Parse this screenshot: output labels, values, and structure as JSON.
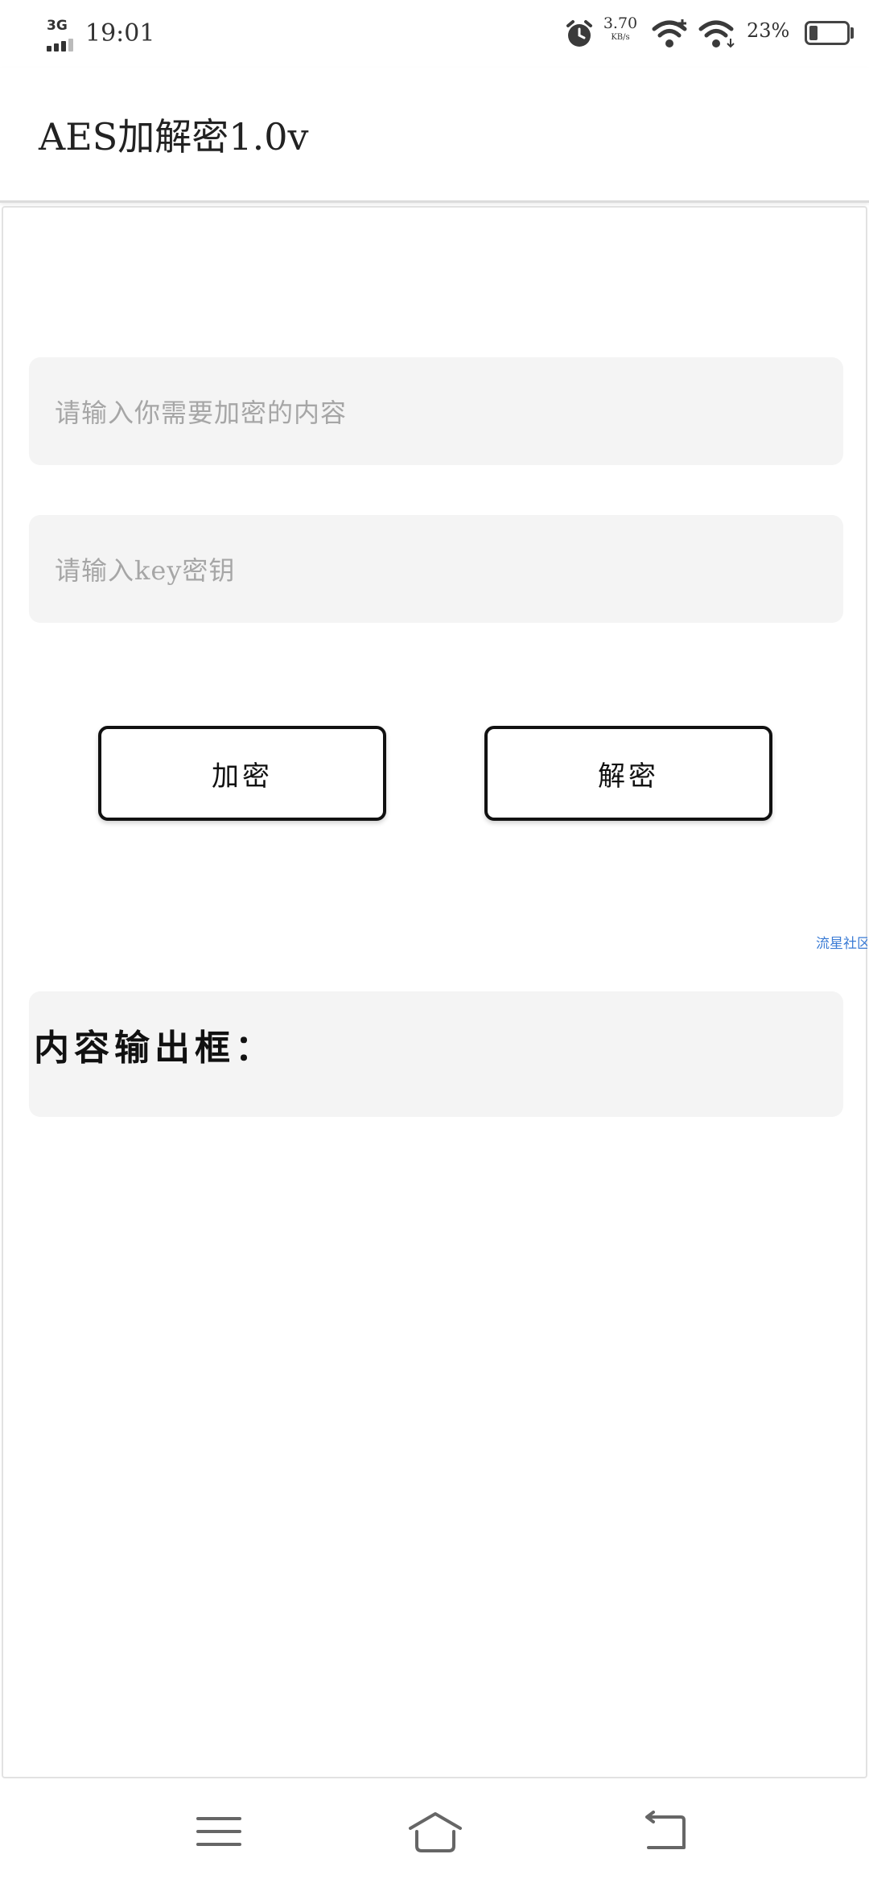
{
  "status_bar": {
    "network_type": "3G",
    "time": "19:01",
    "speed_value": "3.70",
    "speed_unit": "KB/s",
    "battery_percent": "23%",
    "battery_level": 0.23,
    "icons": [
      "signal-icon",
      "alarm-icon",
      "wifi-plus-icon",
      "wifi-icon",
      "battery-icon"
    ]
  },
  "app_bar": {
    "title": "AES加解密1.0v"
  },
  "form": {
    "plaintext_placeholder": "请输入你需要加密的内容",
    "key_placeholder": "请输入key密钥",
    "encrypt_label": "加密",
    "decrypt_label": "解密"
  },
  "community_link": "流星社区",
  "output": {
    "label": "内容输出框：",
    "value": ""
  },
  "nav_bar": {
    "icons": [
      "menu-icon",
      "home-icon",
      "back-icon"
    ]
  },
  "colors": {
    "field_bg": "#f4f4f4",
    "placeholder": "#a6a6a6",
    "button_border": "#111111",
    "link": "#3a7bd5"
  }
}
